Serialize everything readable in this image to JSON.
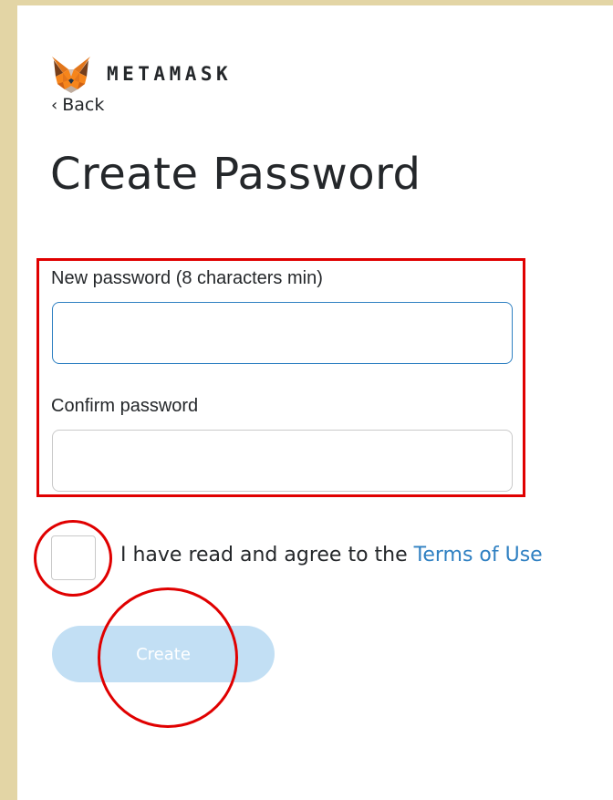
{
  "brand": {
    "logo_icon": "fox-logo-icon",
    "wordmark": "METAMASK",
    "colors": {
      "fox_orange": "#e2761b",
      "fox_dark": "#763e1a",
      "fox_light": "#f6851b"
    }
  },
  "nav": {
    "back_chevron": "‹",
    "back_label": "Back"
  },
  "page": {
    "title": "Create Password"
  },
  "form": {
    "new_password": {
      "label": "New password (8 characters min)",
      "value": "",
      "placeholder": ""
    },
    "confirm_password": {
      "label": "Confirm password",
      "value": "",
      "placeholder": ""
    }
  },
  "terms": {
    "checked": false,
    "text": "I have read and agree to the ",
    "link_label": "Terms of Use",
    "link_color": "#2f80c2"
  },
  "actions": {
    "create_label": "Create",
    "create_enabled": false,
    "create_color": "#c2dff4"
  },
  "annotations": {
    "highlight_color": "#e00000",
    "frame_color": "#e3d5a5"
  }
}
